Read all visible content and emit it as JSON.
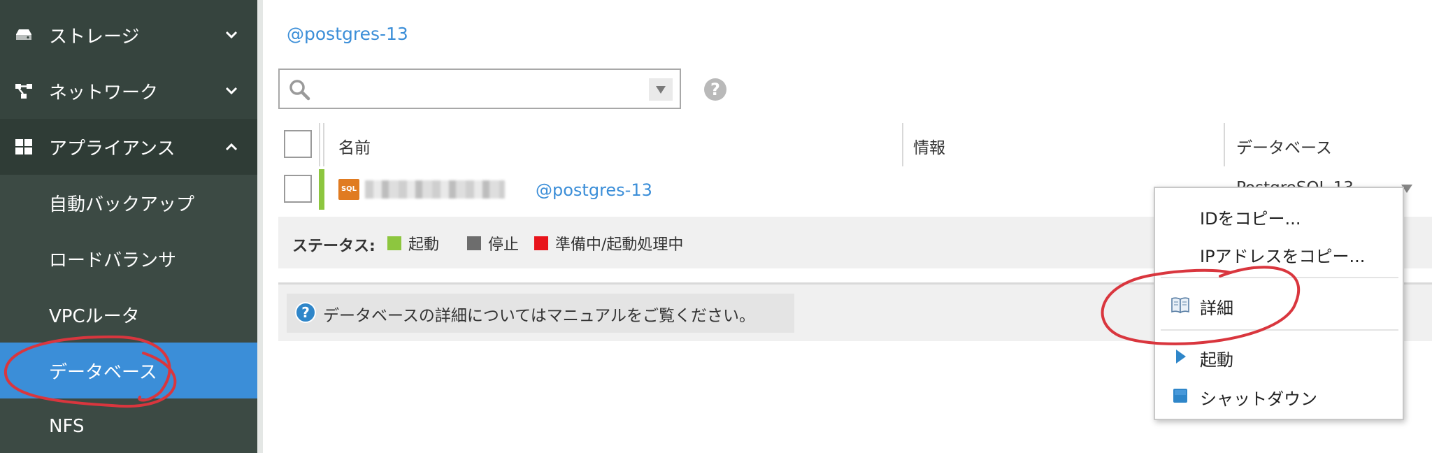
{
  "sidebar": {
    "items": [
      {
        "label": "ストレージ",
        "icon": "storage-icon",
        "state": "collapsed"
      },
      {
        "label": "ネットワーク",
        "icon": "network-icon",
        "state": "collapsed"
      },
      {
        "label": "アプライアンス",
        "icon": "appliance-grid-icon",
        "state": "expanded"
      }
    ],
    "sub_items": [
      {
        "label": "自動バックアップ"
      },
      {
        "label": "ロードバランサ"
      },
      {
        "label": "VPCルータ"
      },
      {
        "label": "データベース",
        "active": true
      },
      {
        "label": "NFS"
      }
    ]
  },
  "main": {
    "breadcrumb": "@postgres-13",
    "search": {
      "value": "",
      "placeholder": ""
    },
    "help_glyph": "?",
    "table": {
      "columns": [
        "名前",
        "情報",
        "データベース"
      ],
      "rows": [
        {
          "name_link": "@postgres-13",
          "icon_text": "SQL",
          "database_partial": "PostgreSQL 13",
          "status": "起動"
        }
      ]
    },
    "status_legend": {
      "title": "ステータス:",
      "items": [
        {
          "label": "起動",
          "color": "#8dc63f"
        },
        {
          "label": "停止",
          "color": "#6d6d6d"
        },
        {
          "label": "準備中/起動処理中",
          "color": "#e8141b"
        }
      ]
    },
    "info": {
      "icon_glyph": "?",
      "text": "データベースの詳細についてはマニュアルをご覧ください。"
    }
  },
  "context_menu": {
    "items": [
      {
        "label": "IDをコピー...",
        "icon": ""
      },
      {
        "label": "IPアドレスをコピー...",
        "icon": ""
      },
      {
        "label": "詳細",
        "icon": "book-icon"
      },
      {
        "label": "起動",
        "icon": "play-icon"
      },
      {
        "label": "シャットダウン",
        "icon": "shutdown-square-icon"
      }
    ]
  },
  "colors": {
    "sidebar_bg": "#36443e",
    "active_nav": "#3b8ed8",
    "link": "#3b8ed8",
    "status_running": "#8dc63f",
    "annotation_red": "#d9363e"
  }
}
